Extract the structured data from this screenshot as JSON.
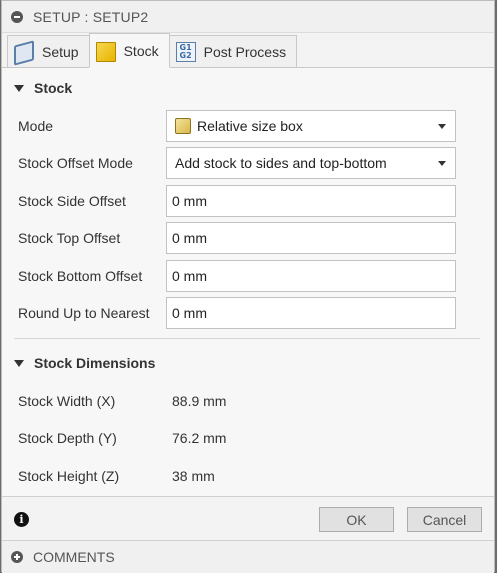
{
  "titlebar": {
    "title": "SETUP : SETUP2"
  },
  "tabs": [
    {
      "label": "Setup",
      "icon": "setup-icon",
      "active": false
    },
    {
      "label": "Stock",
      "icon": "stock-icon",
      "active": true
    },
    {
      "label": "Post Process",
      "icon": "gcode-icon",
      "active": false
    }
  ],
  "stock": {
    "heading": "Stock",
    "mode": {
      "label": "Mode",
      "value": "Relative size box"
    },
    "offset_mode": {
      "label": "Stock Offset Mode",
      "value": "Add stock to sides and top-bottom"
    },
    "side_offset": {
      "label": "Stock Side Offset",
      "value": "0 mm"
    },
    "top_offset": {
      "label": "Stock Top Offset",
      "value": "0 mm"
    },
    "bottom_offset": {
      "label": "Stock Bottom Offset",
      "value": "0 mm"
    },
    "round_up": {
      "label": "Round Up to Nearest",
      "value": "0 mm"
    }
  },
  "dimensions": {
    "heading": "Stock Dimensions",
    "width": {
      "label": "Stock Width (X)",
      "value": "88.9 mm"
    },
    "depth": {
      "label": "Stock Depth (Y)",
      "value": "76.2 mm"
    },
    "height": {
      "label": "Stock Height (Z)",
      "value": "38 mm"
    }
  },
  "footer": {
    "ok_label": "OK",
    "cancel_label": "Cancel"
  },
  "comments": {
    "label": "COMMENTS"
  }
}
